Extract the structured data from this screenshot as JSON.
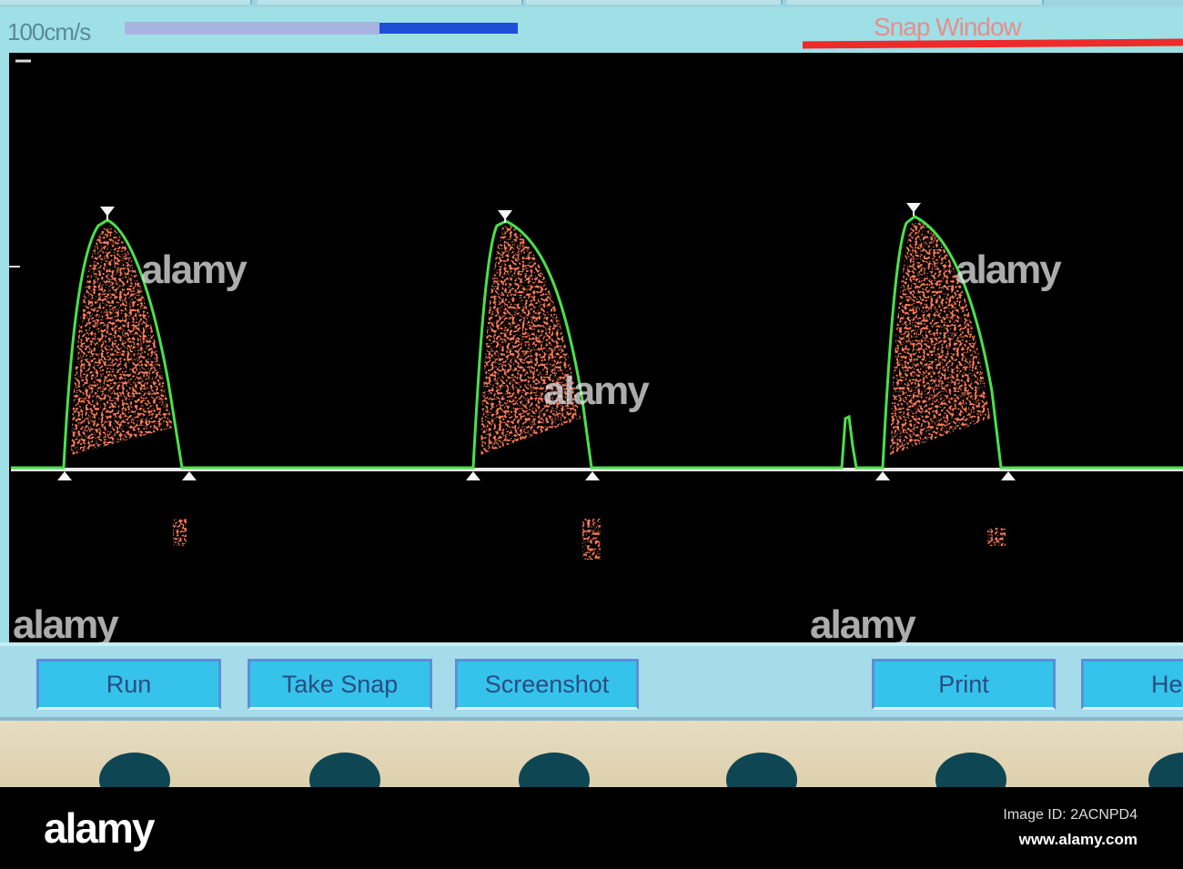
{
  "header": {
    "scale_label": "100cm/s",
    "snap_window_label": "Snap Window"
  },
  "buttons": [
    {
      "label": "Run"
    },
    {
      "label": "Take Snap"
    },
    {
      "label": "Screenshot"
    },
    {
      "label": "Print"
    },
    {
      "label": "He"
    }
  ],
  "watermark": {
    "logo": "alamy",
    "image_id": "Image ID: 2ACNPD4",
    "site": "www.alamy.com"
  },
  "colors": {
    "envelope": "#4be04b",
    "doppler": "#ff2a1a",
    "button": "#35c3ec",
    "accent_blue": "#1f4fd8",
    "snap_red": "#ef2a2a"
  }
}
